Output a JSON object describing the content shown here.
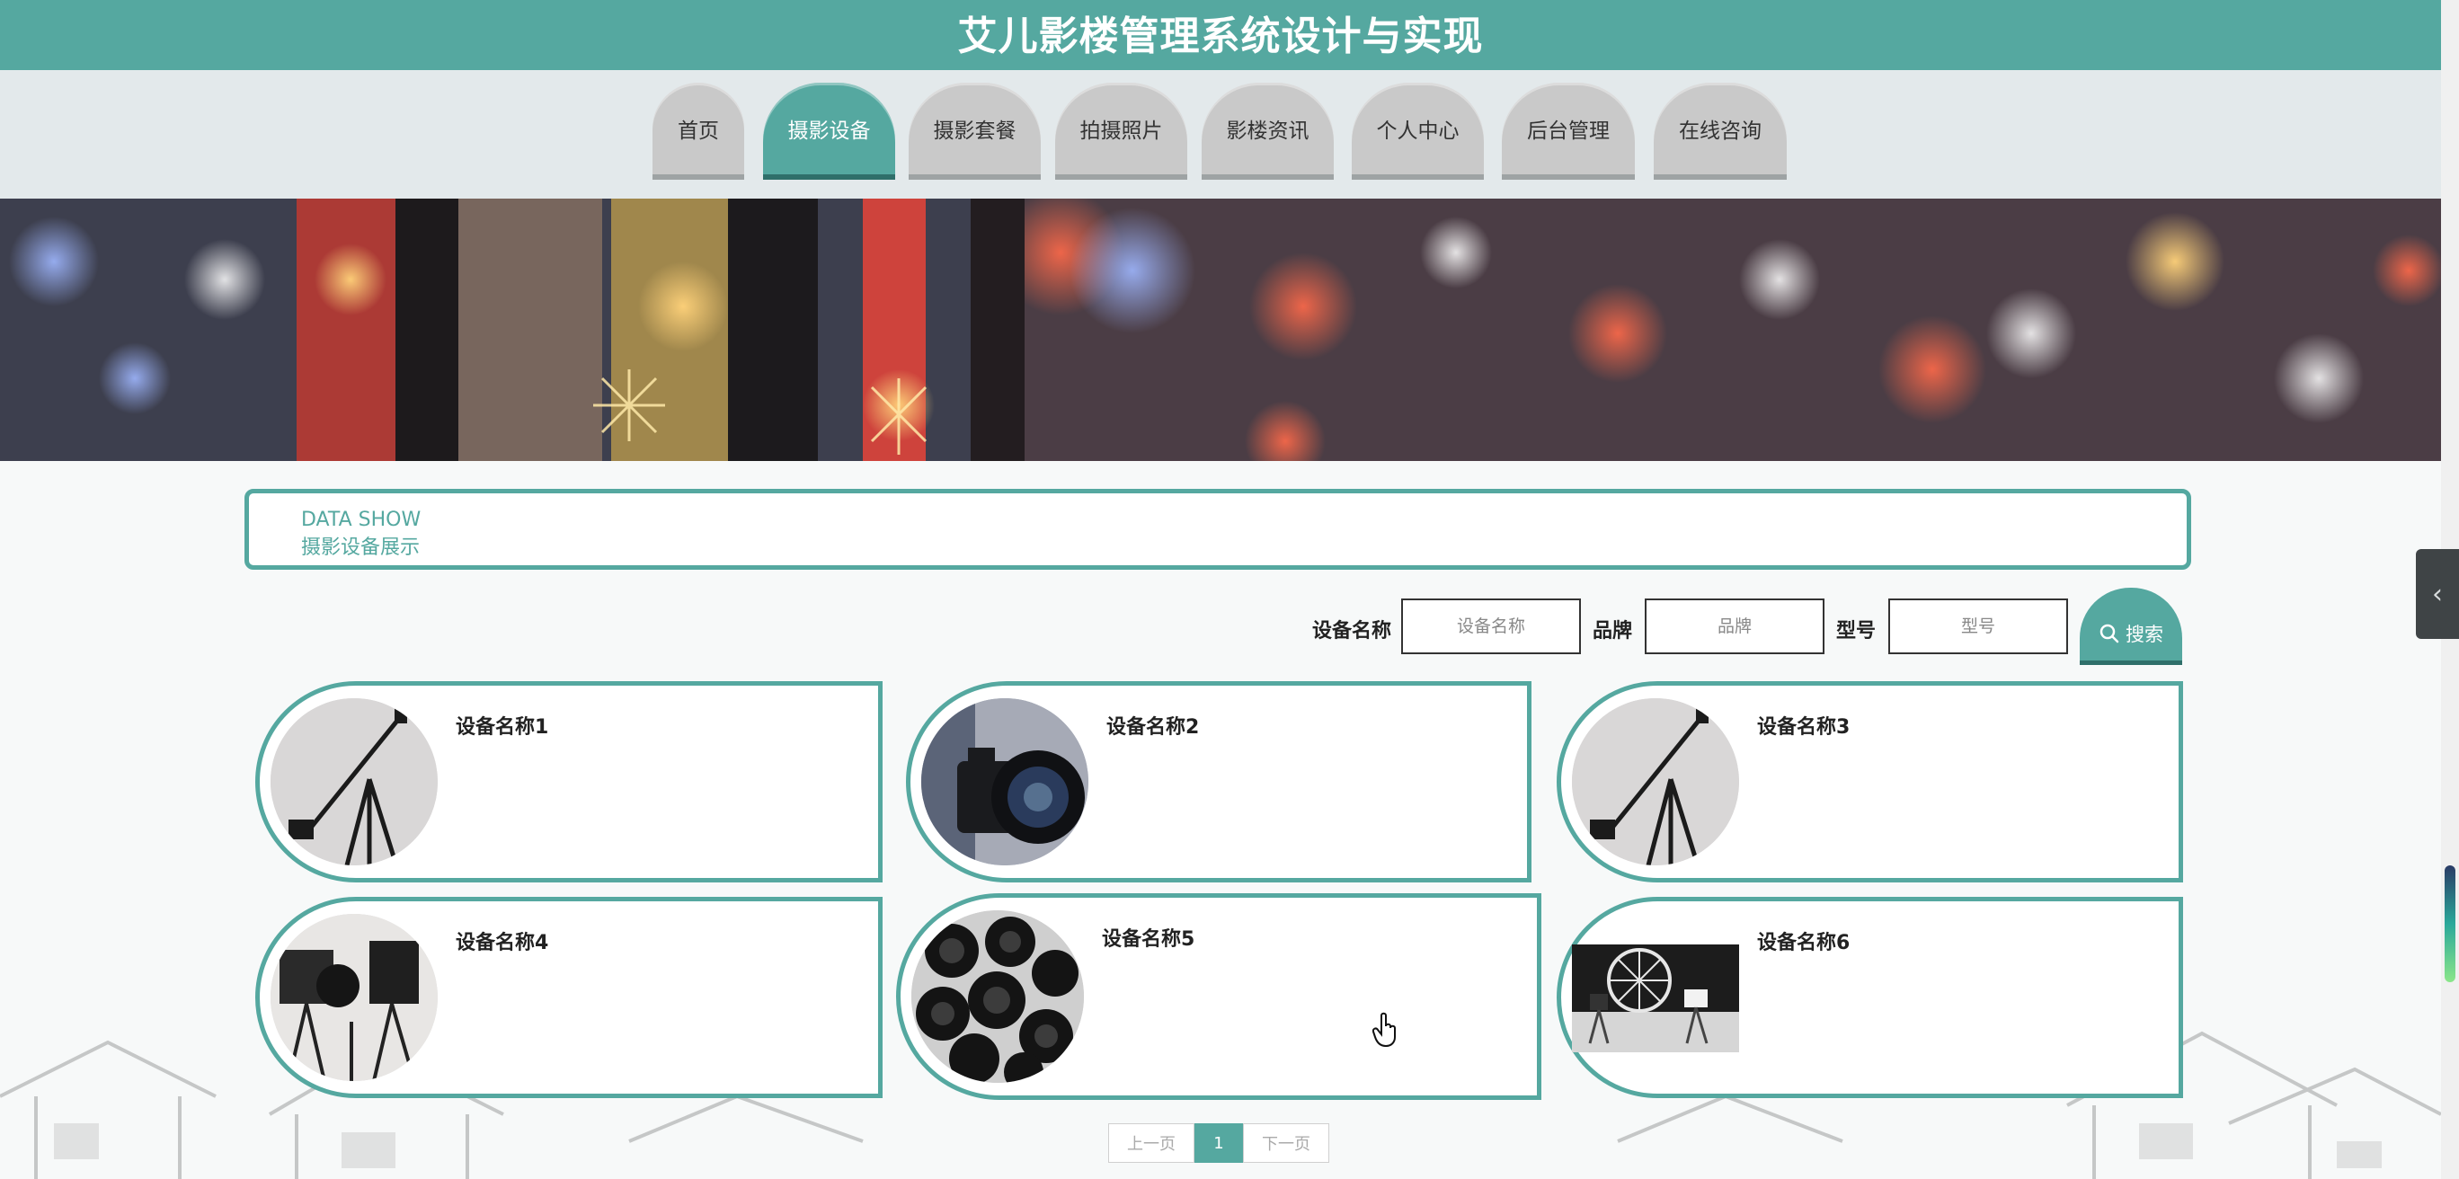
{
  "header": {
    "title": "艾儿影楼管理系统设计与实现"
  },
  "nav": {
    "items": [
      {
        "label": "首页",
        "active": false
      },
      {
        "label": "摄影设备",
        "active": true
      },
      {
        "label": "摄影套餐",
        "active": false
      },
      {
        "label": "拍摄照片",
        "active": false
      },
      {
        "label": "影楼资讯",
        "active": false
      },
      {
        "label": "个人中心",
        "active": false
      },
      {
        "label": "后台管理",
        "active": false
      },
      {
        "label": "在线咨询",
        "active": false
      }
    ]
  },
  "section": {
    "en": "DATA SHOW",
    "cn": "摄影设备展示"
  },
  "search": {
    "name_label": "设备名称",
    "name_placeholder": "设备名称",
    "brand_label": "品牌",
    "brand_placeholder": "品牌",
    "model_label": "型号",
    "model_placeholder": "型号",
    "button_label": "搜索"
  },
  "cards": [
    {
      "name": "设备名称1",
      "image": "camera-crane"
    },
    {
      "name": "设备名称2",
      "image": "camera-lens"
    },
    {
      "name": "设备名称3",
      "image": "camera-crane"
    },
    {
      "name": "设备名称4",
      "image": "film-set"
    },
    {
      "name": "设备名称5",
      "image": "lens-pile"
    },
    {
      "name": "设备名称6",
      "image": "studio-lights"
    }
  ],
  "pagination": {
    "prev_label": "上一页",
    "current_page": "1",
    "next_label": "下一页"
  },
  "colors": {
    "accent": "#55a8a0",
    "accent_dark": "#2f6f6a",
    "nav_inactive": "#c9c9c9",
    "nav_bg": "#e3e9eb"
  },
  "icons": {
    "search": "search-icon",
    "side_toggle": "chevron-left-icon"
  }
}
